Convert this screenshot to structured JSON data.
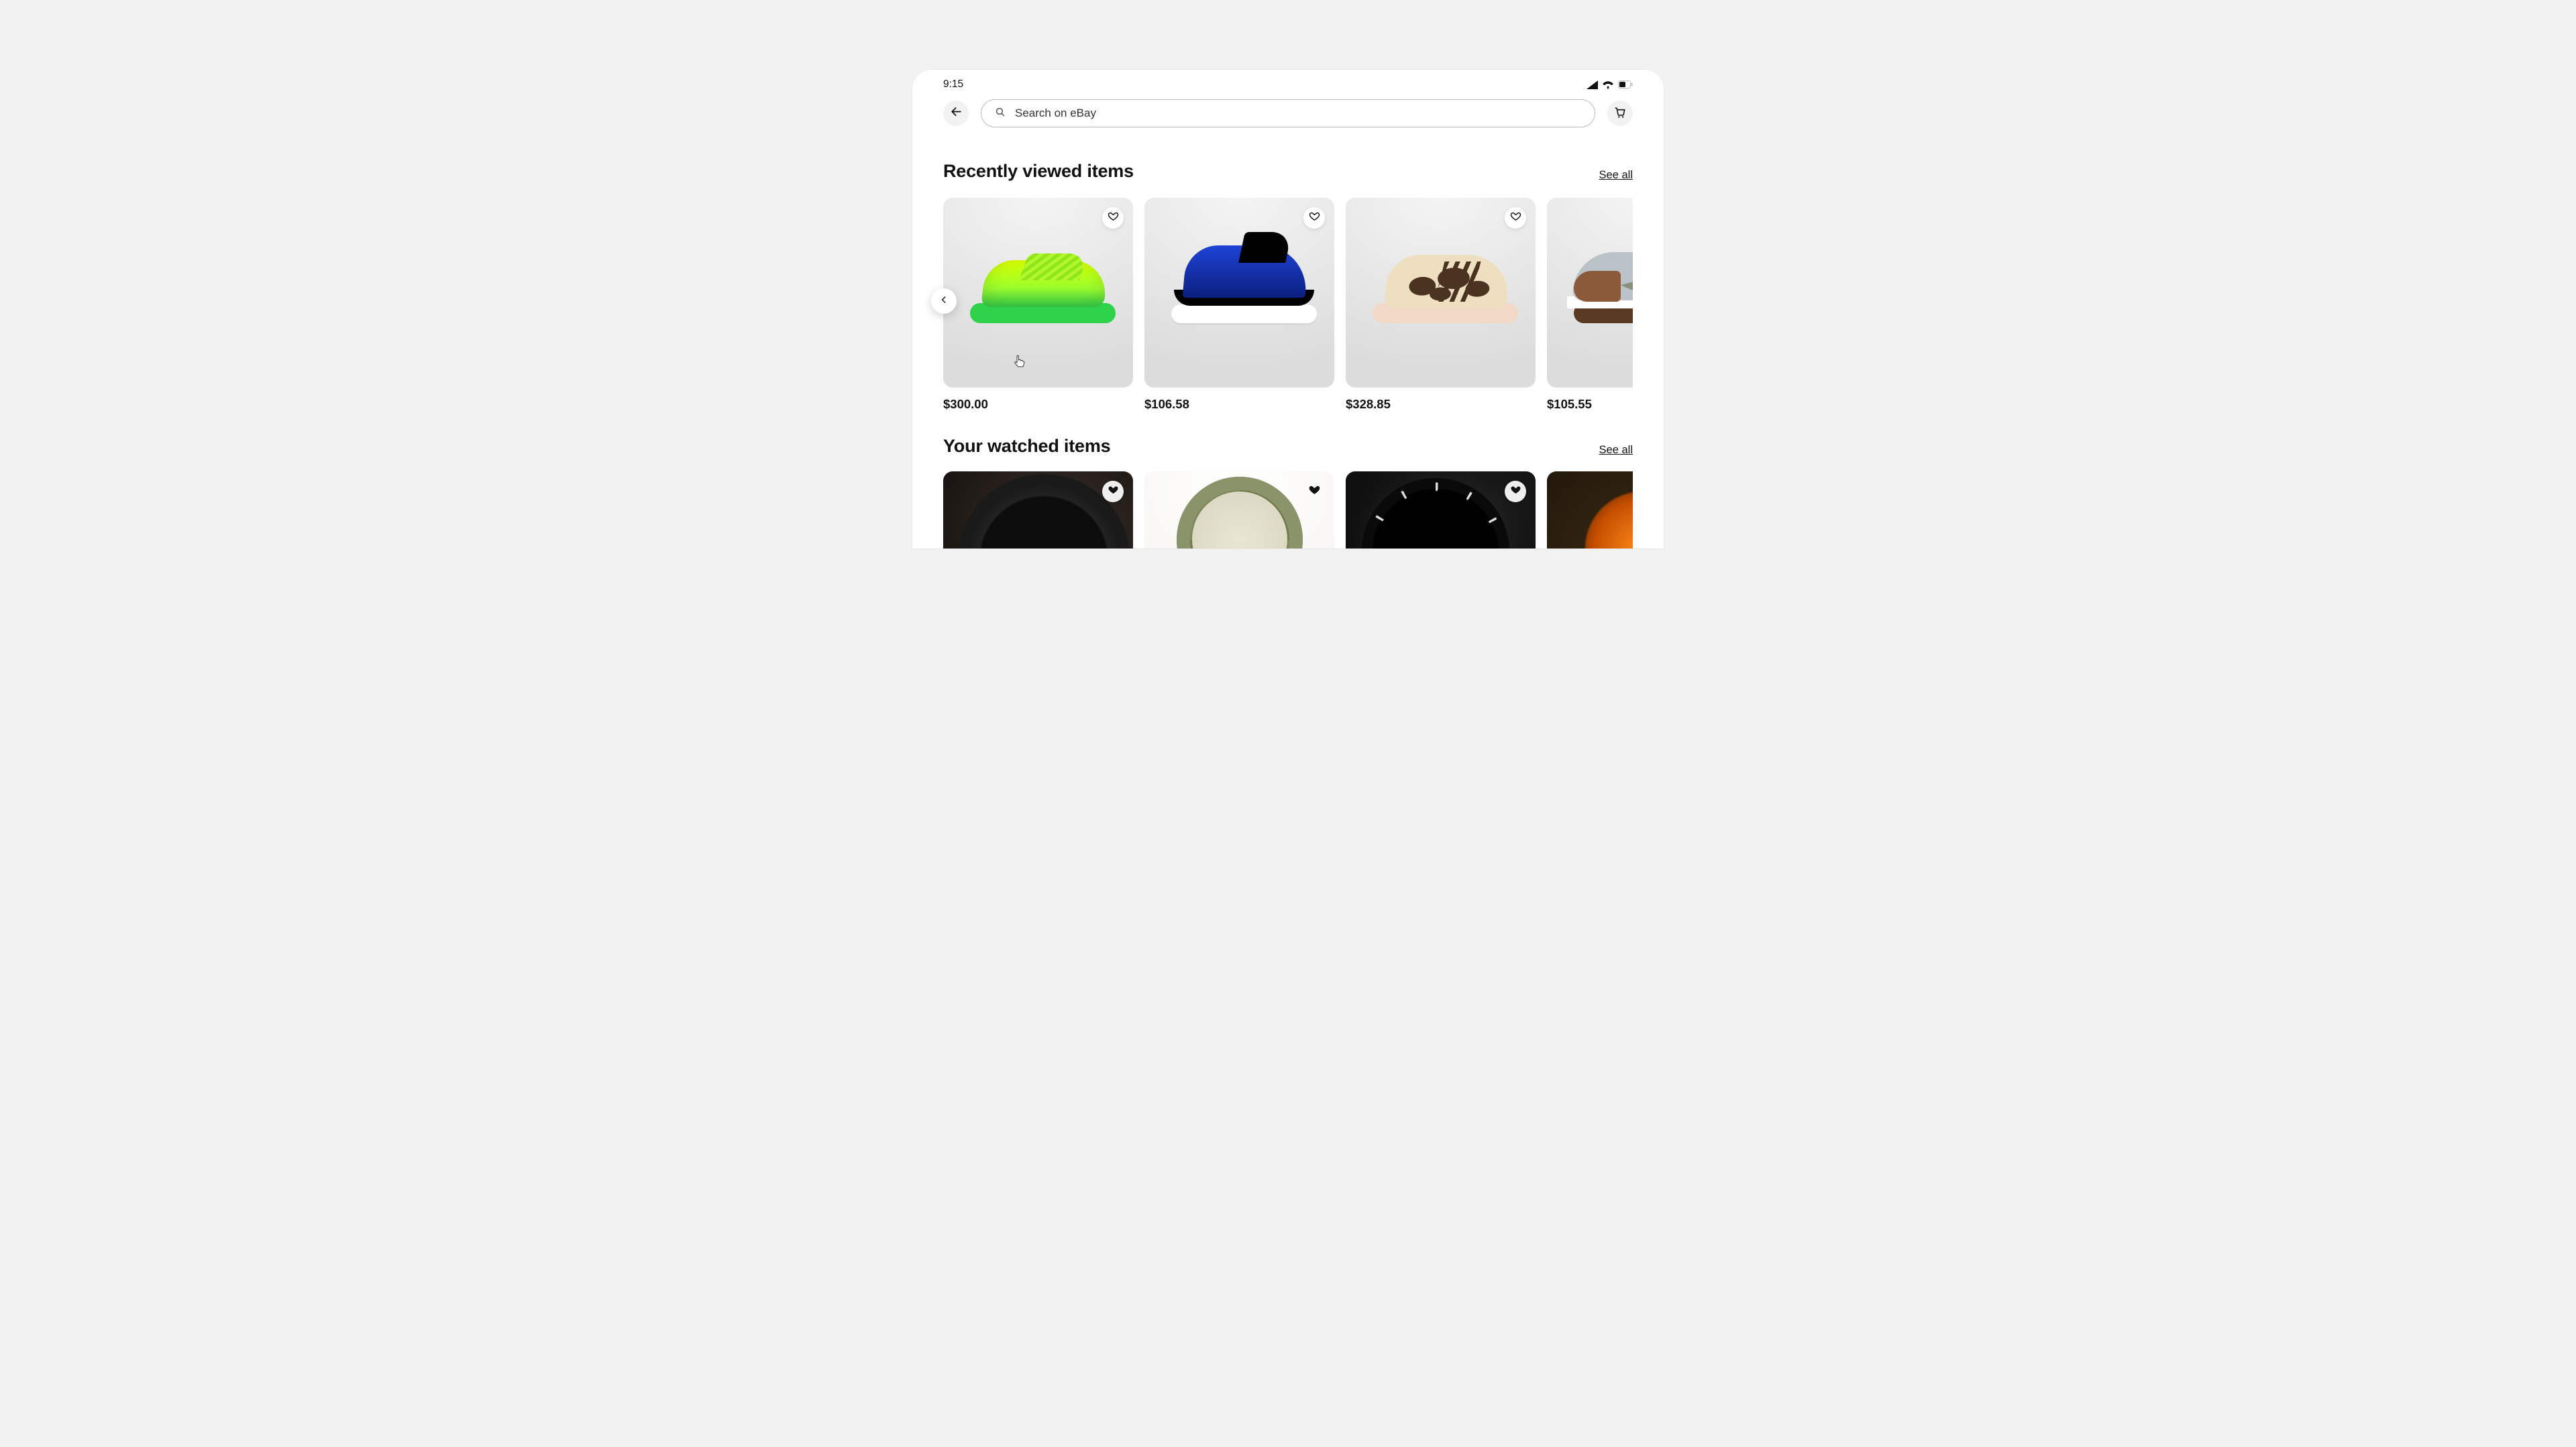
{
  "statusbar": {
    "time": "9:15"
  },
  "header": {
    "search_placeholder": "Search on eBay"
  },
  "sections": {
    "recent": {
      "title": "Recently viewed items",
      "see_all": "See all",
      "items": [
        {
          "price": "$300.00"
        },
        {
          "price": "$106.58"
        },
        {
          "price": "$328.85"
        },
        {
          "price": "$105.55"
        }
      ]
    },
    "watched": {
      "title": "Your watched items",
      "see_all": "See all"
    }
  }
}
